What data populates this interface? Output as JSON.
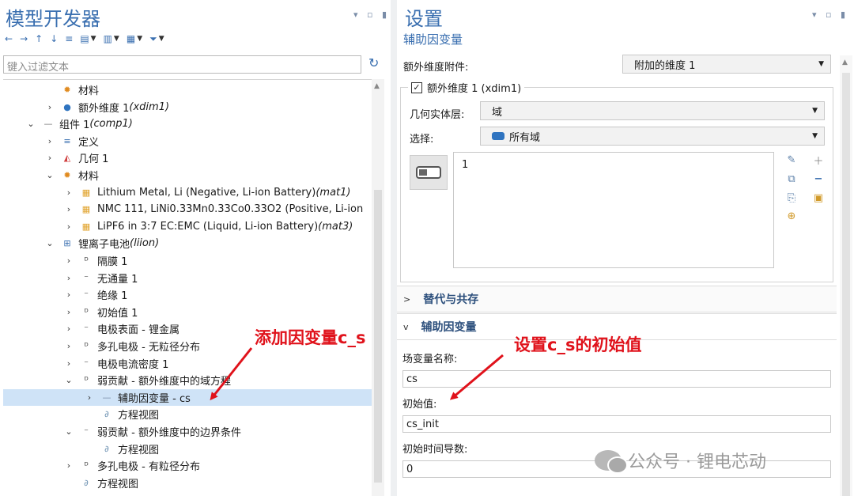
{
  "model_builder": {
    "title": "模型开发器",
    "filter_placeholder": "键入过滤文本",
    "tree": [
      {
        "label": "材料",
        "italic": "",
        "depth": 2,
        "expander": "",
        "icon": "materials-icon",
        "selected": false
      },
      {
        "label": "额外维度 1 ",
        "italic": "(xdim1)",
        "depth": 2,
        "expander": ">",
        "icon": "extra-dimension-icon",
        "selected": false
      },
      {
        "label": "组件 1 ",
        "italic": "(comp1)",
        "depth": 1,
        "expander": "v",
        "icon": "component-icon",
        "selected": false
      },
      {
        "label": "定义",
        "italic": "",
        "depth": 2,
        "expander": ">",
        "icon": "definitions-icon",
        "selected": false
      },
      {
        "label": "几何 1",
        "italic": "",
        "depth": 2,
        "expander": ">",
        "icon": "geometry-icon",
        "selected": false
      },
      {
        "label": "材料",
        "italic": "",
        "depth": 2,
        "expander": "v",
        "icon": "materials-icon",
        "selected": false
      },
      {
        "label": "Lithium Metal, Li (Negative, Li-ion Battery) ",
        "italic": "(mat1)",
        "depth": 3,
        "expander": ">",
        "icon": "material-icon",
        "selected": false
      },
      {
        "label": "NMC 111, LiNi0.33Mn0.33Co0.33O2 (Positive, Li-ion",
        "italic": "",
        "depth": 3,
        "expander": ">",
        "icon": "material-icon",
        "selected": false
      },
      {
        "label": "LiPF6 in 3:7 EC:EMC (Liquid, Li-ion Battery) ",
        "italic": "(mat3)",
        "depth": 3,
        "expander": ">",
        "icon": "material-icon",
        "selected": false
      },
      {
        "label": "锂离子电池 ",
        "italic": "(liion)",
        "depth": 2,
        "expander": "v",
        "icon": "battery-physics-icon",
        "selected": false
      },
      {
        "label": "隔膜 1",
        "italic": "",
        "depth": 3,
        "expander": ">",
        "icon": "domain-feature-icon",
        "selected": false
      },
      {
        "label": "无通量 1",
        "italic": "",
        "depth": 3,
        "expander": ">",
        "icon": "boundary-feature-icon",
        "selected": false
      },
      {
        "label": "绝缘 1",
        "italic": "",
        "depth": 3,
        "expander": ">",
        "icon": "boundary-feature-icon",
        "selected": false
      },
      {
        "label": "初始值 1",
        "italic": "",
        "depth": 3,
        "expander": ">",
        "icon": "domain-feature-icon",
        "selected": false
      },
      {
        "label": "电极表面 - 锂金属",
        "italic": "",
        "depth": 3,
        "expander": ">",
        "icon": "boundary-feature-icon",
        "selected": false
      },
      {
        "label": "多孔电极 - 无粒径分布",
        "italic": "",
        "depth": 3,
        "expander": ">",
        "icon": "domain-feature-icon",
        "selected": false
      },
      {
        "label": "电极电流密度 1",
        "italic": "",
        "depth": 3,
        "expander": ">",
        "icon": "boundary-feature-icon",
        "selected": false
      },
      {
        "label": "弱贡献 - 额外维度中的域方程",
        "italic": "",
        "depth": 3,
        "expander": "v",
        "icon": "domain-feature-icon",
        "selected": false
      },
      {
        "label": "辅助因变量 - cs",
        "italic": "",
        "depth": 4,
        "expander": ">",
        "icon": "dependent-variable-icon",
        "selected": true
      },
      {
        "label": "方程视图",
        "italic": "",
        "depth": 4,
        "expander": "",
        "icon": "equation-view-icon",
        "selected": false
      },
      {
        "label": "弱贡献 - 额外维度中的边界条件",
        "italic": "",
        "depth": 3,
        "expander": "v",
        "icon": "boundary-feature-icon",
        "selected": false
      },
      {
        "label": "方程视图",
        "italic": "",
        "depth": 4,
        "expander": "",
        "icon": "equation-view-icon",
        "selected": false
      },
      {
        "label": "多孔电极 - 有粒径分布",
        "italic": "",
        "depth": 3,
        "expander": ">",
        "icon": "domain-feature-icon",
        "selected": false
      },
      {
        "label": "方程视图",
        "italic": "",
        "depth": 3,
        "expander": "",
        "icon": "equation-view-icon",
        "selected": false
      }
    ]
  },
  "settings": {
    "title": "设置",
    "subtitle": "辅助因变量",
    "attach_label": "额外维度附件:",
    "attach_value": "附加的维度 1",
    "group_label": "额外维度 1 (xdim1)",
    "geom_level_label": "几何实体层:",
    "geom_level_value": "域",
    "selection_label": "选择:",
    "selection_value": "所有域",
    "selection_list": [
      "1"
    ],
    "section_substitution": "替代与共存",
    "section_aux": "辅助因变量",
    "field_name_label": "场变量名称:",
    "field_name_value": "cs",
    "initial_label": "初始值:",
    "initial_value": "cs_init",
    "initial_dt_label": "初始时间导数:",
    "initial_dt_value": "0"
  },
  "annotations": {
    "add_dep_var": "添加因变量c_s",
    "set_initial": "设置c_s的初始值"
  },
  "watermark": "公众号 · 锂电芯动",
  "colors": {
    "accent": "#3a6fb0",
    "selected_row": "#cfe3f7",
    "annotation": "#e0121b"
  }
}
